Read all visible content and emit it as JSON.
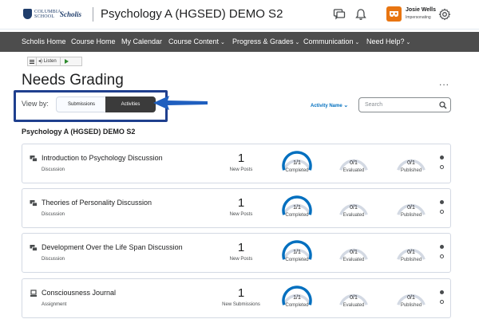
{
  "header": {
    "logo_school": "COLUMBIA SCHOOL",
    "logo_brand": "Scholis",
    "course_title": "Psychology A (HGSED) DEMO S2",
    "user_name": "Josie Wells",
    "user_role": "Impersonating"
  },
  "nav": {
    "items": [
      {
        "label": "Scholis Home",
        "dropdown": false
      },
      {
        "label": "Course Home",
        "dropdown": false
      },
      {
        "label": "My Calendar",
        "dropdown": false
      },
      {
        "label": "Course Content",
        "dropdown": true
      },
      {
        "label": "Progress & Grades",
        "dropdown": true
      },
      {
        "label": "Communication",
        "dropdown": true
      },
      {
        "label": "Need Help?",
        "dropdown": true
      }
    ]
  },
  "listen": {
    "label": "Listen"
  },
  "page": {
    "title": "Needs Grading",
    "more": "..."
  },
  "view_by": {
    "label": "View by:",
    "options": [
      "Submissions",
      "Activities"
    ],
    "selected": "Activities"
  },
  "sort": {
    "label": "Activity Name"
  },
  "search": {
    "placeholder": "Search"
  },
  "section": {
    "title": "Psychology A (HGSED) DEMO S2"
  },
  "activities": [
    {
      "name": "Introduction to Psychology Discussion",
      "type": "Discussion",
      "icon": "discussion-icon",
      "count": "1",
      "count_label": "New Posts",
      "completed": "1/1",
      "evaluated": "0/1",
      "published": "0/1",
      "completed_fraction": 1.0,
      "evaluated_fraction": 0.0,
      "published_fraction": 0.0
    },
    {
      "name": "Theories of Personality Discussion",
      "type": "Discussion",
      "icon": "discussion-icon",
      "count": "1",
      "count_label": "New Posts",
      "completed": "1/1",
      "evaluated": "0/1",
      "published": "0/1",
      "completed_fraction": 1.0,
      "evaluated_fraction": 0.0,
      "published_fraction": 0.0
    },
    {
      "name": "Development Over the Life Span Discussion",
      "type": "Discussion",
      "icon": "discussion-icon",
      "count": "1",
      "count_label": "New Posts",
      "completed": "1/1",
      "evaluated": "0/1",
      "published": "0/1",
      "completed_fraction": 1.0,
      "evaluated_fraction": 0.0,
      "published_fraction": 0.0
    },
    {
      "name": "Consciousness Journal",
      "type": "Assignment",
      "icon": "assignment-icon",
      "count": "1",
      "count_label": "New Submissions",
      "completed": "1/1",
      "evaluated": "0/1",
      "published": "0/1",
      "completed_fraction": 1.0,
      "evaluated_fraction": 0.0,
      "published_fraction": 0.0
    }
  ],
  "gauge_labels": {
    "completed": "Completed",
    "evaluated": "Evaluated",
    "published": "Published"
  },
  "colors": {
    "nav_bg": "#4d4d4d",
    "accent_blue": "#006fbf",
    "gauge_fill": "#006fbf",
    "gauge_track": "#d3d9e3",
    "avatar": "#e87511",
    "highlight": "#1f3f8e"
  }
}
